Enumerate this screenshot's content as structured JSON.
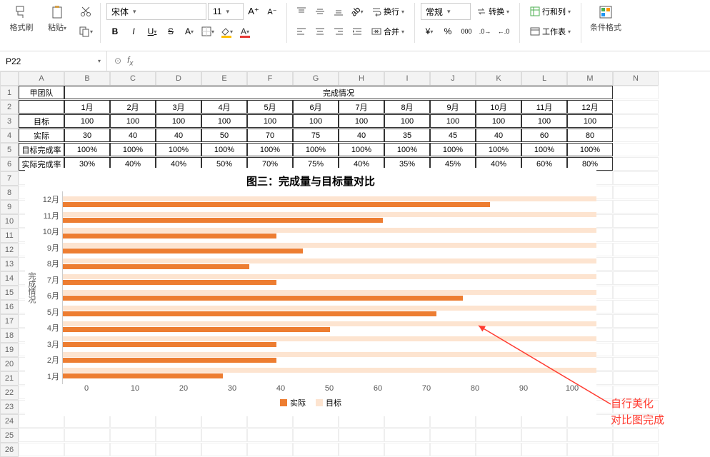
{
  "ribbon": {
    "format_painter": "格式刷",
    "paste": "粘贴",
    "font_name": "宋体",
    "font_size": "11",
    "bold": "B",
    "italic": "I",
    "underline": "U",
    "strike": "S",
    "wrap": "换行",
    "merge": "合并",
    "number_format": "常规",
    "convert": "转换",
    "rows_cols": "行和列",
    "worksheet": "工作表",
    "cond_format": "条件格式"
  },
  "cellref": "P22",
  "columns": [
    "A",
    "B",
    "C",
    "D",
    "E",
    "F",
    "G",
    "H",
    "I",
    "J",
    "K",
    "L",
    "M",
    "N"
  ],
  "table": {
    "team": "甲团队",
    "header_span": "完成情况",
    "months": [
      "1月",
      "2月",
      "3月",
      "4月",
      "5月",
      "6月",
      "7月",
      "8月",
      "9月",
      "10月",
      "11月",
      "12月"
    ],
    "rows": [
      {
        "label": "目标",
        "vals": [
          "100",
          "100",
          "100",
          "100",
          "100",
          "100",
          "100",
          "100",
          "100",
          "100",
          "100",
          "100"
        ]
      },
      {
        "label": "实际",
        "vals": [
          "30",
          "40",
          "40",
          "50",
          "70",
          "75",
          "40",
          "35",
          "45",
          "40",
          "60",
          "80"
        ]
      },
      {
        "label": "目标完成率",
        "vals": [
          "100%",
          "100%",
          "100%",
          "100%",
          "100%",
          "100%",
          "100%",
          "100%",
          "100%",
          "100%",
          "100%",
          "100%"
        ]
      },
      {
        "label": "实际完成率",
        "vals": [
          "30%",
          "40%",
          "40%",
          "50%",
          "70%",
          "75%",
          "40%",
          "35%",
          "45%",
          "40%",
          "60%",
          "80%"
        ]
      }
    ]
  },
  "chart_data": {
    "type": "bar",
    "title": "图三：完成量与目标量对比",
    "y_axis_label": "完成情况",
    "categories": [
      "1月",
      "2月",
      "3月",
      "4月",
      "5月",
      "6月",
      "7月",
      "8月",
      "9月",
      "10月",
      "11月",
      "12月"
    ],
    "series": [
      {
        "name": "实际",
        "values": [
          30,
          40,
          40,
          50,
          70,
          75,
          40,
          35,
          45,
          40,
          60,
          80
        ],
        "color": "#ed7d31"
      },
      {
        "name": "目标",
        "values": [
          100,
          100,
          100,
          100,
          100,
          100,
          100,
          100,
          100,
          100,
          100,
          100
        ],
        "color": "#fde4d0"
      }
    ],
    "x_ticks": [
      0,
      10,
      20,
      30,
      40,
      50,
      60,
      70,
      80,
      90,
      100
    ],
    "xlim": [
      0,
      100
    ]
  },
  "annotation": {
    "line1": "自行美化",
    "line2": "对比图完成"
  }
}
